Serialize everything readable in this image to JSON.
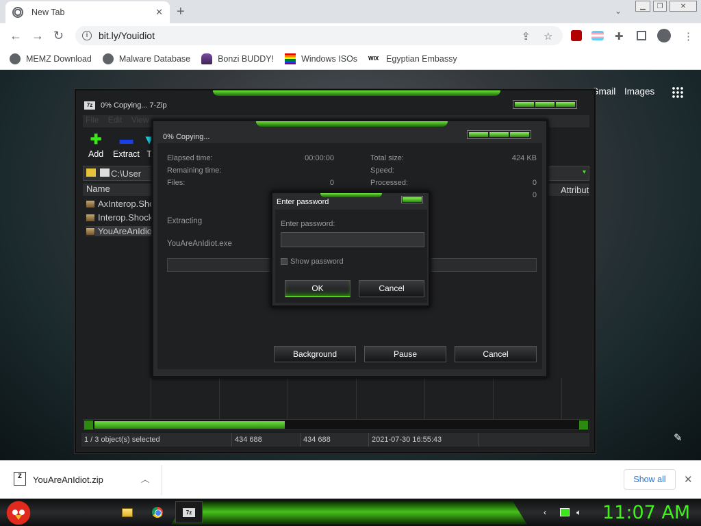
{
  "browser": {
    "tab_title": "New Tab",
    "url": "bit.ly/Youidiot",
    "bookmarks": [
      {
        "label": "MEMZ Download"
      },
      {
        "label": "Malware Database"
      },
      {
        "label": "Bonzi BUDDY!"
      },
      {
        "label": "Windows ISOs"
      },
      {
        "label": "Egyptian Embassy",
        "prefix": "WIX"
      }
    ]
  },
  "newtab_page": {
    "gmail": "Gmail",
    "images": "Images"
  },
  "zip_window": {
    "title": "0% Copying... 7-Zip",
    "icon_text": "7z",
    "menu": [
      "File",
      "Edit",
      "View"
    ],
    "toolbar": {
      "add": "Add",
      "extract": "Extract",
      "test": "T"
    },
    "path": "C:\\User",
    "columns": {
      "name": "Name",
      "attributes": "Attribut"
    },
    "files": [
      "AxInterop.Shoc",
      "Interop.Shock",
      "YouAreAnIdio"
    ],
    "status": {
      "selected": "1 / 3 object(s) selected",
      "size": "434 688",
      "packed": "434 688",
      "modified": "2021-07-30 16:55:43"
    }
  },
  "copy_dialog": {
    "title": "0% Copying...",
    "elapsed_label": "Elapsed time:",
    "elapsed_value": "00:00:00",
    "remaining_label": "Remaining time:",
    "files_label": "Files:",
    "files_value": "0",
    "total_size_label": "Total size:",
    "total_size_value": "424 KB",
    "speed_label": "Speed:",
    "processed_label": "Processed:",
    "processed_value": "0",
    "extra_value": "0",
    "extracting_label": "Extracting",
    "current_file": "YouAreAnIdiot.exe",
    "progress": 0,
    "buttons": {
      "background": "Background",
      "pause": "Pause",
      "cancel": "Cancel"
    }
  },
  "password_dialog": {
    "title": "Enter password",
    "field_label": "Enter password:",
    "field_value": "",
    "show_password": "Show password",
    "ok": "OK",
    "cancel": "Cancel"
  },
  "downloads": {
    "file": "YouAreAnIdiot.zip",
    "show_all": "Show all"
  },
  "taskbar": {
    "clock": "11:07 AM",
    "zip_icon": "7z"
  },
  "colors": {
    "accent_green": "#3ef21a",
    "link_blue": "#1a73e8"
  }
}
